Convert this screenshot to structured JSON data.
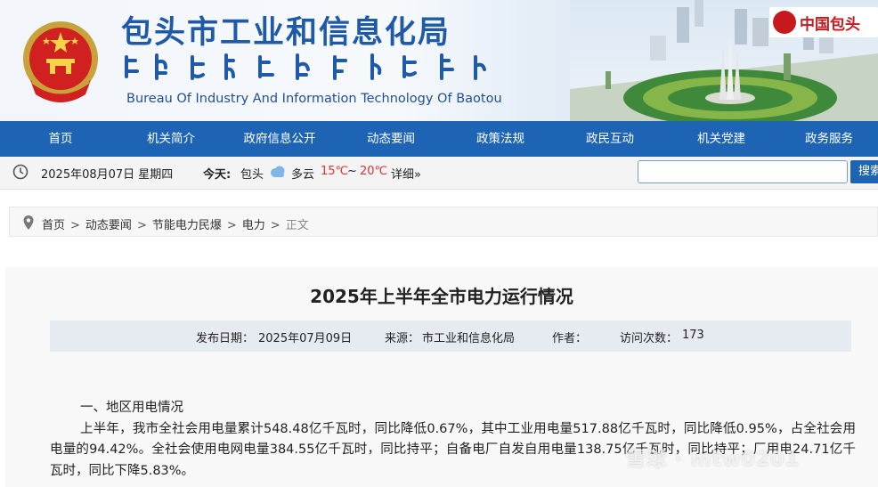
{
  "header": {
    "title_cn": "包头市工业和信息化局",
    "title_en": "Bureau Of Industry And Information Technology  Of  Baotou",
    "brand": "中国包头"
  },
  "nav": {
    "items": [
      "首页",
      "机关简介",
      "政府信息公开",
      "动态要闻",
      "政策法规",
      "政民互动",
      "机关党建",
      "政务服务"
    ]
  },
  "infobar": {
    "date": "2025年08月07日 星期四",
    "weather_label": "今天:",
    "city": "包头",
    "condition": "多云",
    "temp_low": "15℃",
    "temp_sep": "~",
    "temp_high": "20℃",
    "detail": "详细»",
    "search_placeholder": "",
    "search_button": "搜索"
  },
  "breadcrumb": {
    "items": [
      "首页",
      "动态要闻",
      "节能电力民爆",
      "电力"
    ],
    "current": "正文",
    "separator": ">"
  },
  "article": {
    "title": "2025年上半年全市电力运行情况",
    "meta": {
      "date_label": "发布日期：",
      "date": "2025年07月09日",
      "source_label": "来源：",
      "source": "市工业和信息化局",
      "author_label": "作者：",
      "author": "",
      "visits_label": "访问次数：",
      "visits": "173"
    },
    "section_heading": "一、地区用电情况",
    "paragraph": "上半年，我市全社会用电量累计548.48亿千瓦时，同比降低0.67%，其中工业用电量517.88亿千瓦时，同比降低0.95%，占全社会用电量的94.42%。全社会使用电网电量384.55亿千瓦时，同比持平；自备电厂自发自用电量138.75亿千瓦时，同比持平；厂用电24.71亿千瓦时，同比下降5.83%。"
  },
  "watermark": "雪球 · mtw0201",
  "colors": {
    "nav_bg": "#1e64b4",
    "title_blue": "#1f5aa8",
    "brand_red": "#c6181d",
    "temp_red": "#e03030"
  },
  "icons": [
    "national-emblem-icon",
    "clock-icon",
    "cloud-icon",
    "location-pin-icon",
    "search-icon"
  ]
}
